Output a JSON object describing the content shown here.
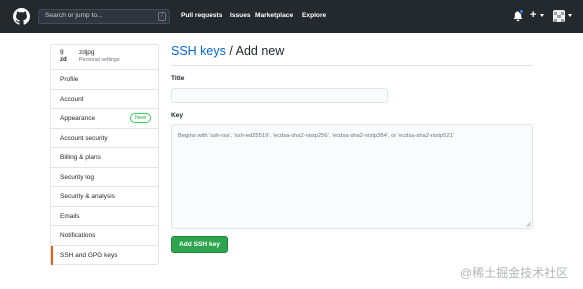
{
  "header": {
    "search_placeholder": "Search or jump to...",
    "search_key": "/",
    "nav": [
      "Pull requests",
      "Issues",
      "Marketplace",
      "Explore"
    ],
    "plus_label": "+"
  },
  "sidebar": {
    "username": "zdjpg",
    "user_subtitle": "Personal settings",
    "avatar_text_1": "g",
    "avatar_text_2": "zd",
    "items": [
      {
        "label": "Profile"
      },
      {
        "label": "Account"
      },
      {
        "label": "Appearance",
        "badge": "New"
      },
      {
        "label": "Account security"
      },
      {
        "label": "Billing & plans"
      },
      {
        "label": "Security log"
      },
      {
        "label": "Security & analysis"
      },
      {
        "label": "Emails"
      },
      {
        "label": "Notifications"
      },
      {
        "label": "SSH and GPG keys",
        "selected": true
      }
    ]
  },
  "main": {
    "title_link": "SSH keys",
    "title_rest": " / Add new",
    "title_label": "Title",
    "title_value": "",
    "key_label": "Key",
    "key_placeholder": "Begins with 'ssh-rsa', 'ssh-ed25519', 'ecdsa-sha2-nistp256', 'ecdsa-sha2-nistp384', or 'ecdsa-sha2-nistp521'",
    "submit_label": "Add SSH key"
  },
  "watermark": "@稀土掘金技术社区",
  "colors": {
    "header_bg": "#24292e",
    "link": "#0366d6",
    "primary_button": "#2ea44f",
    "selected_accent": "#e36209",
    "new_badge": "#28a745",
    "notification_dot": "#2188ff"
  }
}
